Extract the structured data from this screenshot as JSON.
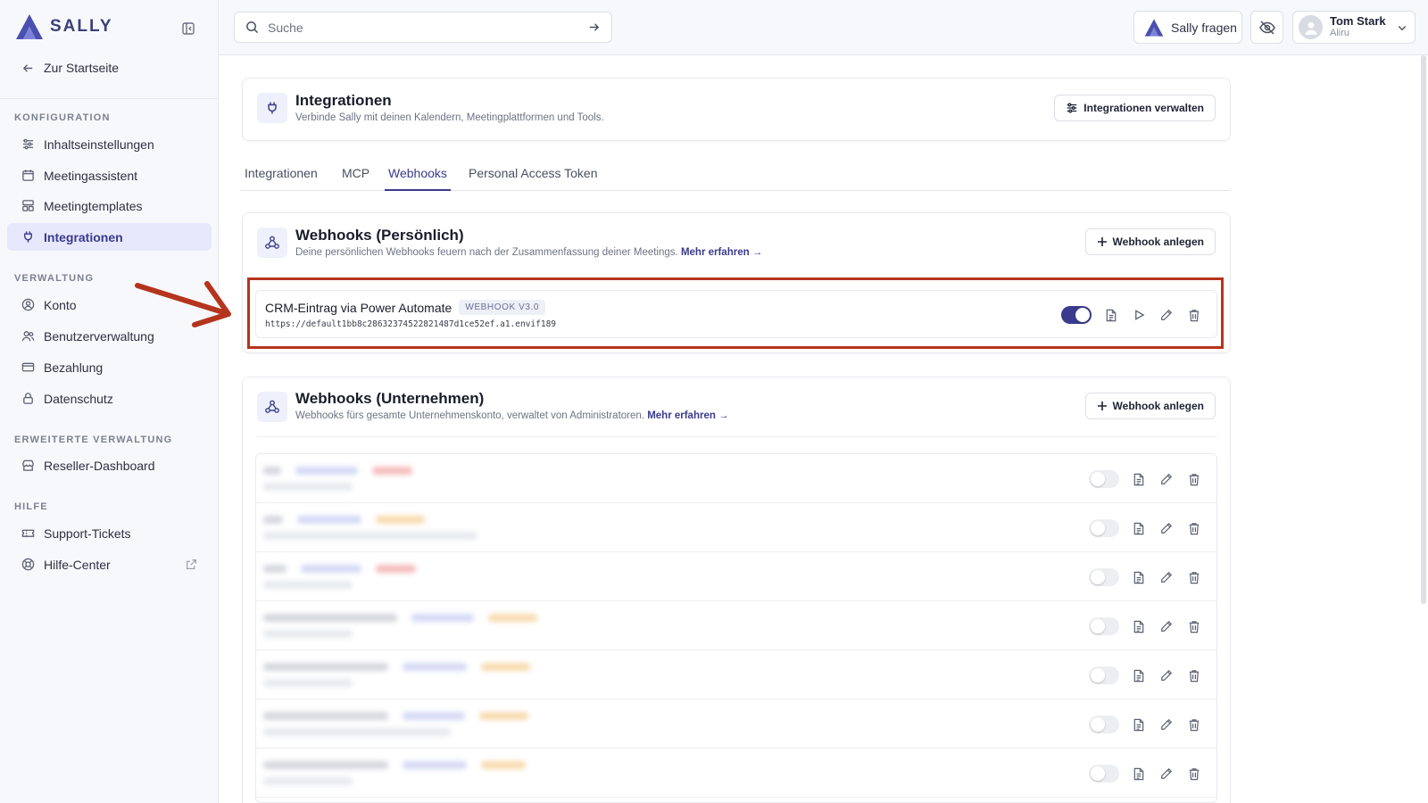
{
  "brand": {
    "name": "SALLY",
    "accent": "#3a3a8e"
  },
  "sidebar": {
    "home_label": "Zur Startseite",
    "sections": [
      {
        "title": "KONFIGURATION",
        "items": [
          {
            "label": "Inhaltseinstellungen",
            "icon": "sliders-icon"
          },
          {
            "label": "Meetingassistent",
            "icon": "calendar-icon"
          },
          {
            "label": "Meetingtemplates",
            "icon": "template-icon"
          },
          {
            "label": "Integrationen",
            "icon": "plug-icon",
            "active": true
          }
        ]
      },
      {
        "title": "VERWALTUNG",
        "items": [
          {
            "label": "Konto",
            "icon": "user-circle-icon"
          },
          {
            "label": "Benutzerverwaltung",
            "icon": "users-icon"
          },
          {
            "label": "Bezahlung",
            "icon": "credit-card-icon"
          },
          {
            "label": "Datenschutz",
            "icon": "lock-icon"
          }
        ]
      },
      {
        "title": "ERWEITERTE VERWALTUNG",
        "items": [
          {
            "label": "Reseller-Dashboard",
            "icon": "store-icon"
          }
        ]
      },
      {
        "title": "HILFE",
        "items": [
          {
            "label": "Support-Tickets",
            "icon": "ticket-icon"
          },
          {
            "label": "Hilfe-Center",
            "icon": "lifebuoy-icon",
            "external": true
          }
        ]
      }
    ]
  },
  "topbar": {
    "search_placeholder": "Suche",
    "ask_sally": "Sally fragen",
    "user": {
      "name": "Tom Stark",
      "org": "Aliru"
    }
  },
  "integrations_header": {
    "title": "Integrationen",
    "subtitle": "Verbinde Sally mit deinen Kalendern, Meetingplattformen und Tools.",
    "manage_button": "Integrationen verwalten"
  },
  "tabs": [
    {
      "label": "Integrationen",
      "active": false
    },
    {
      "label": "MCP",
      "active": false
    },
    {
      "label": "Webhooks",
      "active": true
    },
    {
      "label": "Personal Access Token",
      "active": false
    }
  ],
  "personal_webhooks": {
    "title": "Webhooks (Persönlich)",
    "subtitle": "Deine persönlichen Webhooks feuern nach der Zusammenfassung deiner Meetings.",
    "more_link": "Mehr erfahren →",
    "create_button": "Webhook anlegen",
    "items": [
      {
        "name": "CRM-Eintrag via Power Automate",
        "version": "WEBHOOK V3.0",
        "url": "https://default1bb8c28632374522821487d1ce52ef.a1.envif189",
        "enabled": true
      }
    ]
  },
  "company_webhooks": {
    "title": "Webhooks (Unternehmen)",
    "subtitle": "Webhooks fürs gesamte Unternehmenskonto, verwaltet von Administratoren.",
    "more_link": "Mehr erfahren →",
    "create_button": "Webhook anlegen",
    "blurred_row_count": 7
  },
  "colors": {
    "highlight": "#b5341d",
    "toggle_on": "#3a3a8e"
  }
}
